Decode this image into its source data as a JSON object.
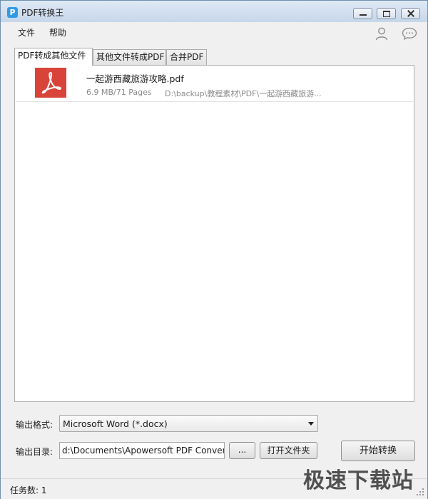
{
  "window": {
    "title": "PDF转换王"
  },
  "menu": {
    "file": "文件",
    "help": "帮助"
  },
  "tabs": [
    {
      "label": "PDF转成其他文件",
      "active": true
    },
    {
      "label": "其他文件转成PDF",
      "active": false
    },
    {
      "label": "合并PDF",
      "active": false
    }
  ],
  "files": [
    {
      "name": "一起游西藏旅游攻略.pdf",
      "meta": "6.9 MB/71 Pages",
      "path": "D:\\backup\\教程素材\\PDF\\一起游西藏旅游..."
    }
  ],
  "output": {
    "format_label": "输出格式:",
    "format_value": "Microsoft Word (*.docx)",
    "dir_label": "输出目录:",
    "dir_value": "d:\\Documents\\Apowersoft PDF Converter",
    "browse_label": "...",
    "open_folder_label": "打开文件夹",
    "start_label": "开始转换"
  },
  "status": {
    "tasks": "任务数: 1"
  },
  "watermark": "极速下载站",
  "colors": {
    "pdf_icon": "#d9443a",
    "app_icon": "#2f9be5"
  },
  "icons": {
    "app": "app-logo-icon",
    "user": "user-icon",
    "chat": "chat-bubble-icon",
    "pdf": "pdf-file-icon"
  }
}
